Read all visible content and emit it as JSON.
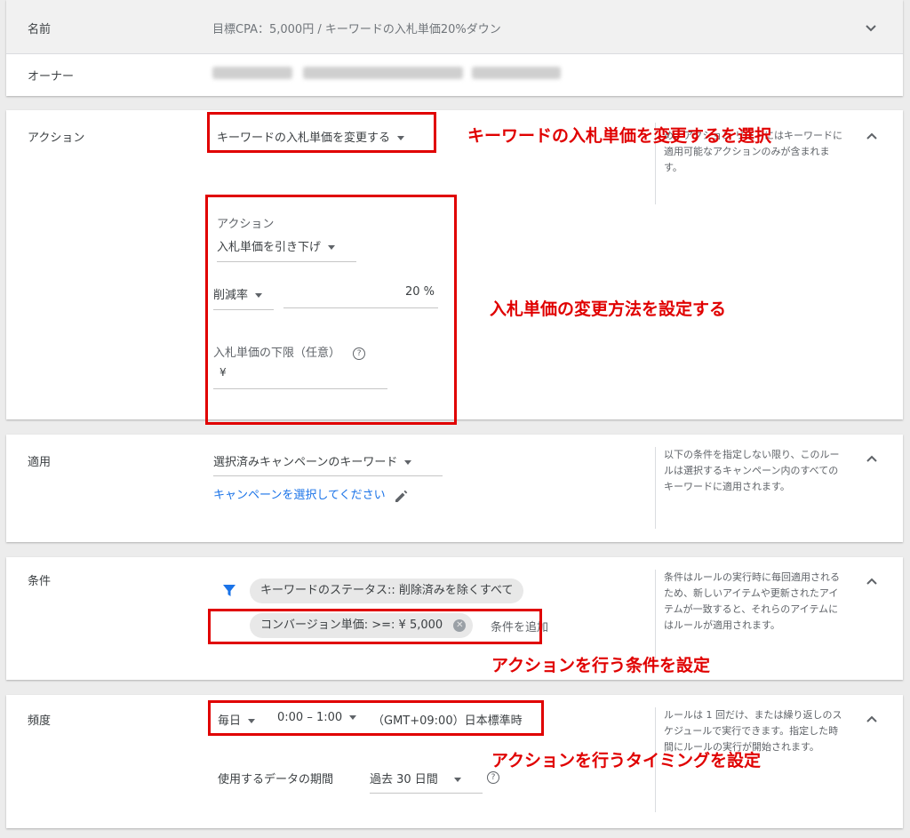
{
  "name_row": {
    "label": "名前",
    "value": "目標CPA：5,000円 / キーワードの入札単価20%ダウン"
  },
  "owner_row": {
    "label": "オーナー"
  },
  "action_section": {
    "label": "アクション",
    "selected_action": "キーワードの入札単価を変更する",
    "annotation": "キーワードの入札単価を変更するを選択",
    "help_text": "め、アクション リストにはキーワードに適用可能なアクションのみが含まれます。",
    "sub_label": "アクション",
    "bid_action": "入札単価を引き下げ",
    "reduction_type": "削減率",
    "reduction_value": "20 %",
    "min_bid_label": "入札単価の下限（任意）",
    "currency": "¥",
    "annotation2": "入札単価の変更方法を設定する"
  },
  "apply_section": {
    "label": "適用",
    "selected": "選択済みキャンペーンのキーワード",
    "link": "キャンペーンを選択してください",
    "help_text": "以下の条件を指定しない限り、このルールは選択するキャンペーン内のすべてのキーワードに適用されます。"
  },
  "condition_section": {
    "label": "条件",
    "chip1": "キーワードのステータス:: 削除済みを除くすべて",
    "chip2": "コンバージョン単価: >=: ¥ 5,000",
    "add_condition": "条件を追加",
    "help_text": "条件はルールの実行時に毎回適用されるため、新しいアイテムや更新されたアイテムが一致すると、それらのアイテムにはルールが適用されます。",
    "annotation": "アクションを行う条件を設定"
  },
  "frequency_section": {
    "label": "頻度",
    "frequency": "毎日",
    "time": "0:00 – 1:00",
    "timezone": "（GMT+09:00）日本標準時",
    "data_period_label": "使用するデータの期間",
    "data_period": "過去 30 日間",
    "help_text": "ルールは 1 回だけ、または繰り返しのスケジュールで実行できます。指定した時間にルールの実行が開始されます。",
    "annotation": "アクションを行うタイミングを設定"
  },
  "colors": {
    "annotation_red": "#e00000",
    "link_blue": "#1a73e8",
    "filter_icon": "#1a73e8"
  }
}
